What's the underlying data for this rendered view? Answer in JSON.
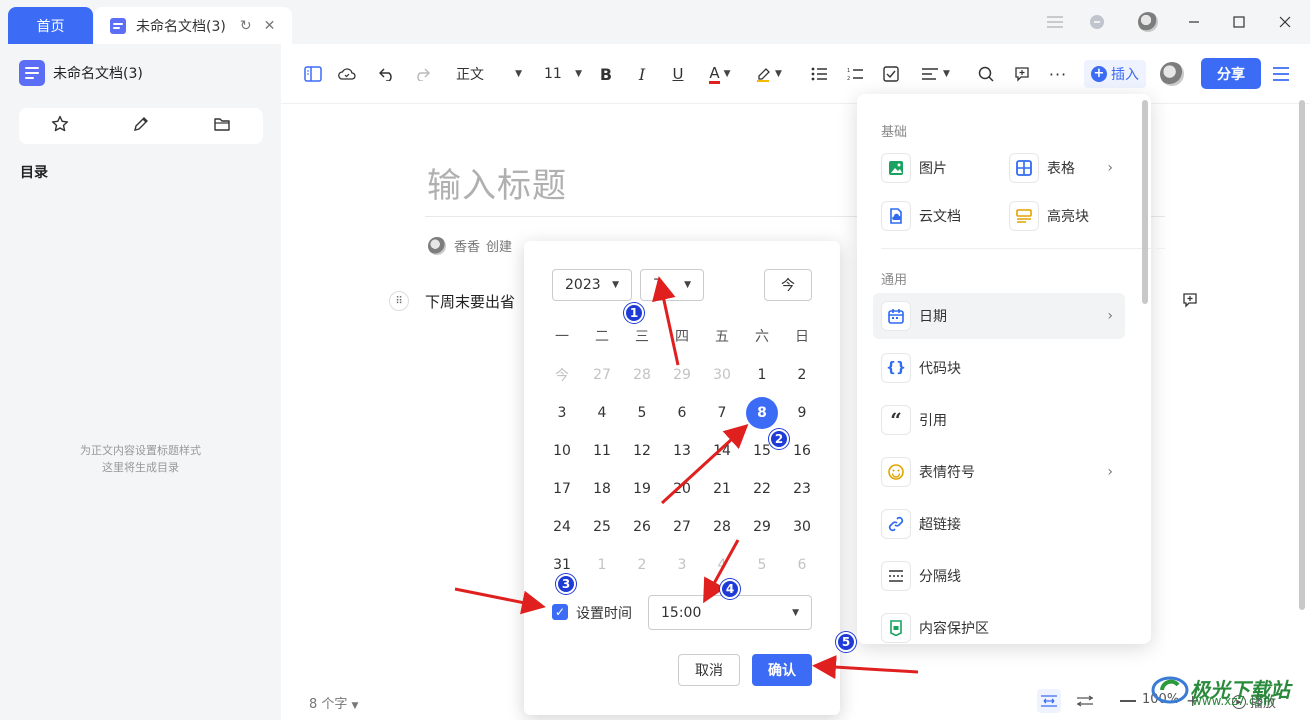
{
  "titlebar": {
    "home_tab": "首页",
    "doc_tab": "未命名文档(3)"
  },
  "sidebar": {
    "doc_name": "未命名文档(3)",
    "toc_label": "目录",
    "hint_line1": "为正文内容设置标题样式",
    "hint_line2": "这里将生成目录"
  },
  "toolbar": {
    "style": "正文",
    "font_size": "11",
    "insert_label": "插入",
    "share_label": "分享"
  },
  "editor": {
    "title_placeholder": "输入标题",
    "author": "香香",
    "created": "创建",
    "paragraph": "下周末要出省"
  },
  "datepicker": {
    "year": "2023",
    "month": "7",
    "today_button": "今",
    "weekdays": [
      "一",
      "二",
      "三",
      "四",
      "五",
      "六",
      "日"
    ],
    "weeks": [
      [
        "今",
        "27",
        "28",
        "29",
        "30",
        "1",
        "2"
      ],
      [
        "3",
        "4",
        "5",
        "6",
        "7",
        "8",
        "9"
      ],
      [
        "10",
        "11",
        "12",
        "13",
        "14",
        "15",
        "16"
      ],
      [
        "17",
        "18",
        "19",
        "20",
        "21",
        "22",
        "23"
      ],
      [
        "24",
        "25",
        "26",
        "27",
        "28",
        "29",
        "30"
      ],
      [
        "31",
        "1",
        "2",
        "3",
        "4",
        "5",
        "6"
      ]
    ],
    "selected_day": "8",
    "set_time_label": "设置时间",
    "set_time_checked": true,
    "time_value": "15:00",
    "cancel_label": "取消",
    "confirm_label": "确认"
  },
  "insert_panel": {
    "basic_header": "基础",
    "basic_items": [
      "图片",
      "表格",
      "云文档",
      "高亮块"
    ],
    "general_header": "通用",
    "general_items": [
      "日期",
      "代码块",
      "引用",
      "表情符号",
      "超链接",
      "分隔线",
      "内容保护区"
    ]
  },
  "footer": {
    "word_count": "8 个字",
    "zoom": "100%",
    "play": "播放"
  },
  "annotations": {
    "badges": [
      "1",
      "2",
      "3",
      "4",
      "5"
    ]
  },
  "watermark": {
    "text": "极光下载站",
    "url": "www.xz7.com"
  },
  "colors": {
    "accent": "#3c6cf5",
    "badge": "#1f3bd6",
    "arrow": "#e0201f"
  }
}
